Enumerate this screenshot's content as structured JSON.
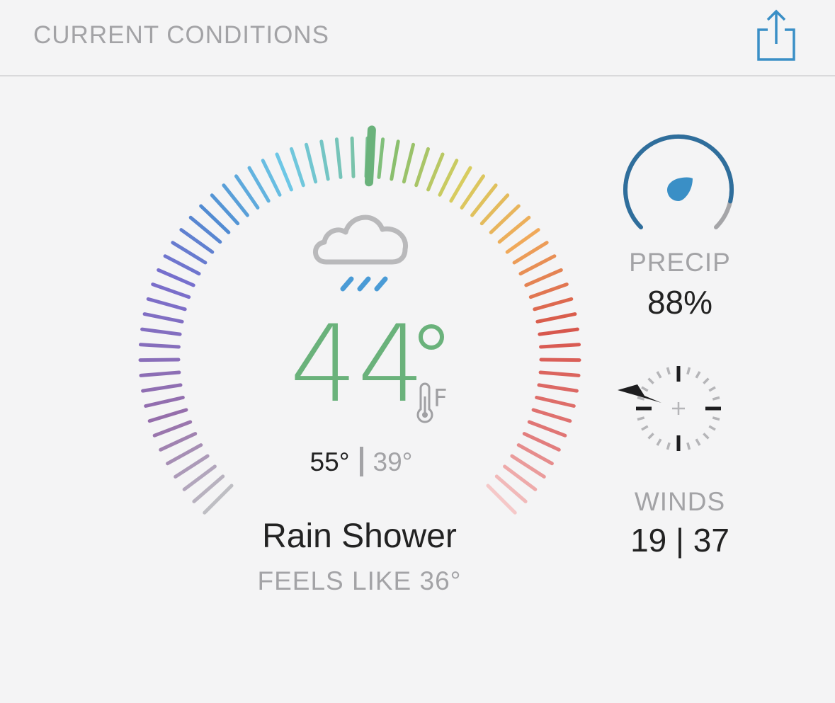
{
  "header": {
    "title": "CURRENT CONDITIONS",
    "share_icon": "share-icon",
    "accent_color": "#3a8fc6"
  },
  "gauge": {
    "current_temp_position": 0.5,
    "needle_color": "#6ab27b"
  },
  "current": {
    "temperature": "44",
    "unit": "F",
    "high": "55°",
    "low": "39°",
    "condition": "Rain Shower",
    "feels_like": "FEELS LIKE 36°",
    "condition_icon": "rain-cloud-icon",
    "temp_color": "#6ab27b"
  },
  "precip": {
    "label": "PRECIP",
    "value": "88%",
    "icon": "raindrop-icon",
    "fill_fraction": 0.88
  },
  "winds": {
    "label": "WINDS",
    "value": "19 | 37",
    "icon": "compass-icon",
    "direction": "W"
  }
}
